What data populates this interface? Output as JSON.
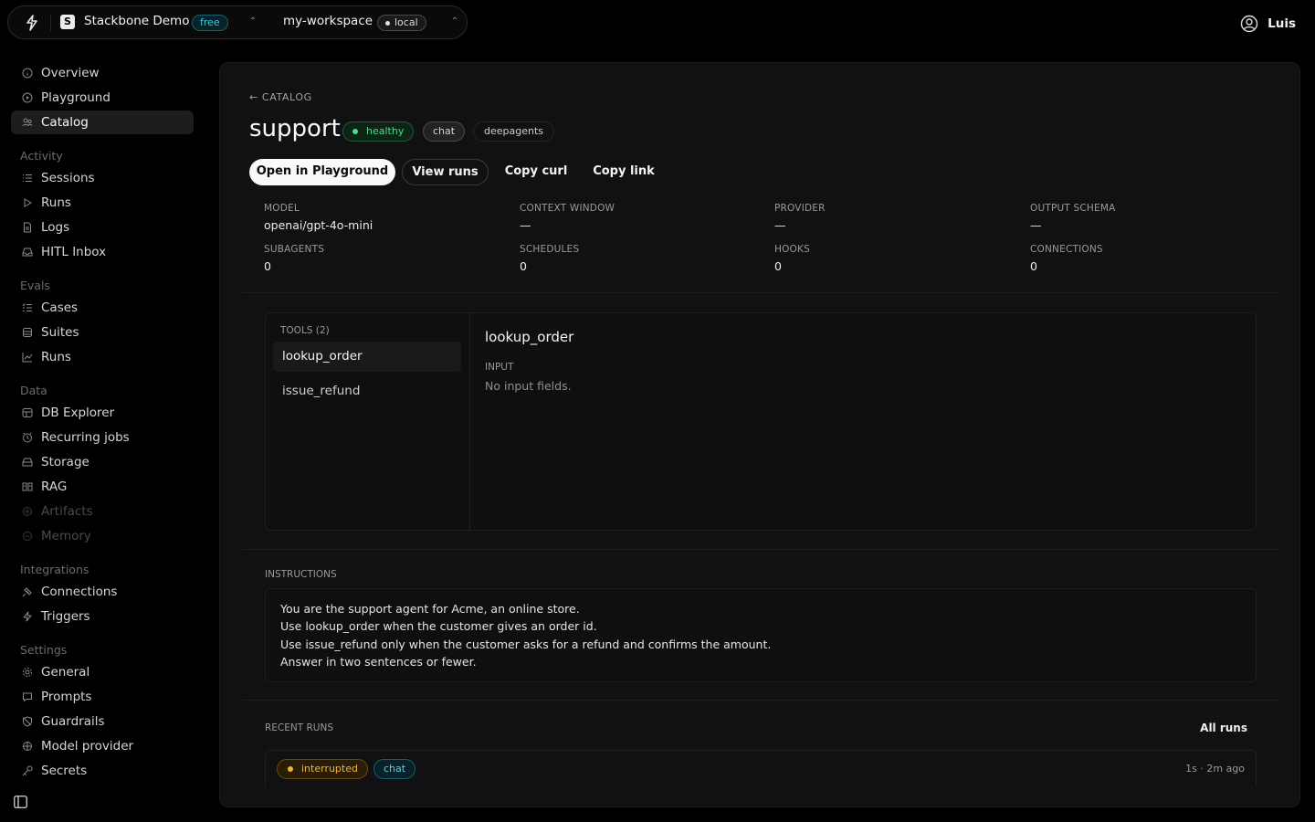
{
  "topbar": {
    "org_name": "Stackbone Demo",
    "org_initial": "S",
    "plan_badge": "free",
    "workspace_name": "my-workspace",
    "env_badge": "local",
    "user_name": "Luis"
  },
  "sidebar": {
    "items_top": [
      {
        "label": "Overview",
        "icon": "info-icon"
      },
      {
        "label": "Playground",
        "icon": "play-icon"
      },
      {
        "label": "Catalog",
        "icon": "agents-icon",
        "active": true
      }
    ],
    "sections": [
      {
        "title": "Activity",
        "items": [
          {
            "label": "Sessions",
            "icon": "list-icon"
          },
          {
            "label": "Runs",
            "icon": "play-icon"
          },
          {
            "label": "Logs",
            "icon": "file-icon"
          },
          {
            "label": "HITL Inbox",
            "icon": "inbox-icon"
          }
        ]
      },
      {
        "title": "Evals",
        "items": [
          {
            "label": "Cases",
            "icon": "checklist-icon"
          },
          {
            "label": "Suites",
            "icon": "stack-icon"
          },
          {
            "label": "Runs",
            "icon": "chart-icon"
          }
        ]
      },
      {
        "title": "Data",
        "items": [
          {
            "label": "DB Explorer",
            "icon": "database-icon"
          },
          {
            "label": "Recurring jobs",
            "icon": "clock-icon"
          },
          {
            "label": "Storage",
            "icon": "storage-icon"
          },
          {
            "label": "RAG",
            "icon": "book-icon"
          },
          {
            "label": "Artifacts",
            "icon": "artifact-icon",
            "disabled": true
          },
          {
            "label": "Memory",
            "icon": "brain-icon",
            "disabled": true
          }
        ]
      },
      {
        "title": "Integrations",
        "items": [
          {
            "label": "Connections",
            "icon": "plug-icon"
          },
          {
            "label": "Triggers",
            "icon": "bolt-icon"
          }
        ]
      },
      {
        "title": "Settings",
        "items": [
          {
            "label": "General",
            "icon": "gear-icon"
          },
          {
            "label": "Prompts",
            "icon": "message-icon"
          },
          {
            "label": "Guardrails",
            "icon": "shield-icon"
          },
          {
            "label": "Model provider",
            "icon": "model-icon"
          },
          {
            "label": "Secrets",
            "icon": "key-icon"
          }
        ]
      }
    ]
  },
  "agent": {
    "back_label": "← CATALOG",
    "name": "support",
    "status": "healthy",
    "tags": [
      "chat",
      "deepagents"
    ],
    "actions": {
      "open_playground": "Open in Playground",
      "view_runs": "View runs",
      "copy_curl": "Copy curl",
      "copy_link": "Copy link"
    },
    "meta": [
      {
        "label": "MODEL",
        "value": "openai/gpt-4o-mini"
      },
      {
        "label": "CONTEXT WINDOW",
        "value": "—"
      },
      {
        "label": "PROVIDER",
        "value": "—"
      },
      {
        "label": "OUTPUT SCHEMA",
        "value": "—"
      },
      {
        "label": "SUBAGENTS",
        "value": "0"
      },
      {
        "label": "SCHEDULES",
        "value": "0"
      },
      {
        "label": "HOOKS",
        "value": "0"
      },
      {
        "label": "CONNECTIONS",
        "value": "0"
      }
    ],
    "tools": {
      "header": "TOOLS (2)",
      "items": [
        "lookup_order",
        "issue_refund"
      ],
      "selected": {
        "name": "lookup_order",
        "input_label": "INPUT",
        "empty_text": "No input fields."
      }
    },
    "instructions": {
      "label": "INSTRUCTIONS",
      "lines": [
        "You are the support agent for Acme, an online store.",
        "Use lookup_order when the customer gives an order id.",
        "Use issue_refund only when the customer asks for a refund and confirms the amount.",
        "Answer in two sentences or fewer."
      ]
    },
    "recent_runs": {
      "label": "RECENT RUNS",
      "all_runs": "All runs",
      "rows": [
        {
          "status": "interrupted",
          "tag": "chat",
          "time": "1s · 2m ago"
        }
      ]
    }
  },
  "colors": {
    "background": "#000000",
    "panel": "#111113",
    "healthy": "#4ade80",
    "interrupted": "#f3b33d",
    "accent": "#3fc6dc"
  }
}
